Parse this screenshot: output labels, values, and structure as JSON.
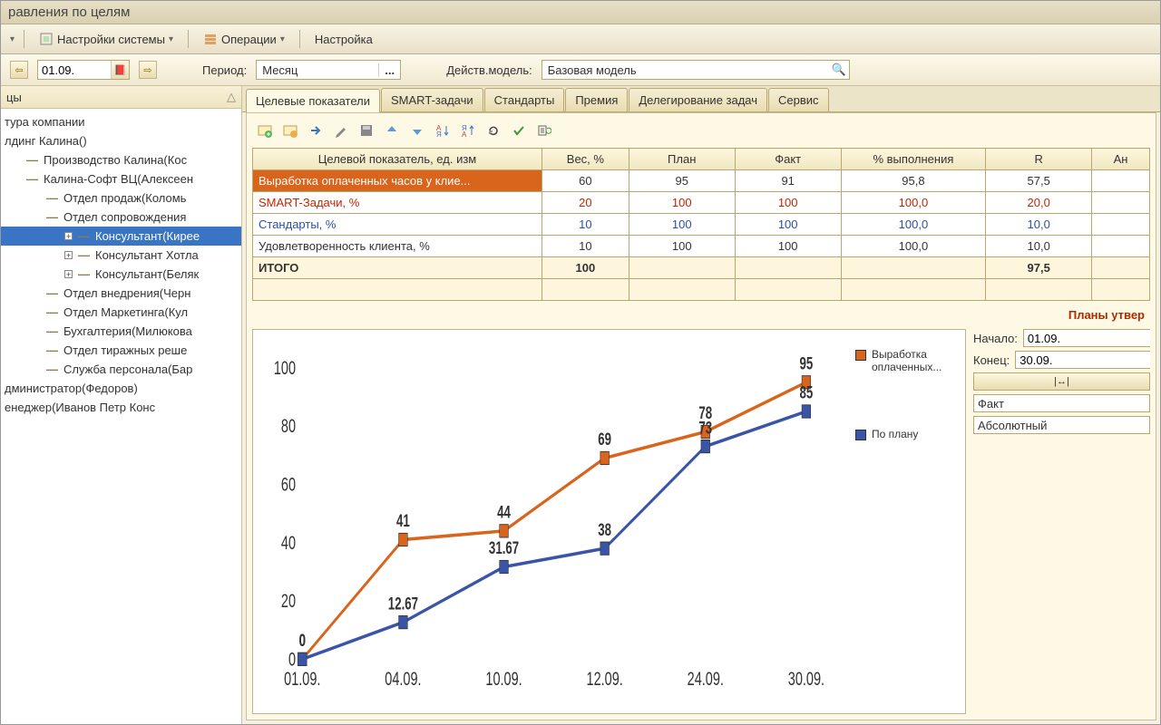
{
  "title": "равления по целям",
  "menu": {
    "settings": "Настройки системы",
    "ops": "Операции",
    "setup": "Настройка"
  },
  "toolbar": {
    "date": "01.09.",
    "period_label": "Период:",
    "period_value": "Месяц",
    "model_label": "Действ.модель:",
    "model_value": "Базовая модель"
  },
  "side_title": "цы",
  "tree": [
    {
      "text": "тура компании",
      "ind": 0
    },
    {
      "text": "лдинг Калина()",
      "ind": 0
    },
    {
      "text": "Производство Калина(Кос",
      "ind": 1,
      "dash": true
    },
    {
      "text": "Калина-Софт ВЦ(Алексеен",
      "ind": 1,
      "dash": true
    },
    {
      "text": "Отдел продаж(Коломь",
      "ind": 2,
      "dash": true
    },
    {
      "text": "Отдел сопровождения",
      "ind": 2,
      "dash": true
    },
    {
      "text": "Консультант(Кирее",
      "ind": 3,
      "plus": true,
      "dash": true,
      "sel": true
    },
    {
      "text": "Консультант Хотла",
      "ind": 3,
      "plus": true,
      "dash": true
    },
    {
      "text": "Консультант(Беляк",
      "ind": 3,
      "plus": true,
      "dash": true
    },
    {
      "text": "Отдел внедрения(Черн",
      "ind": 2,
      "dash": true
    },
    {
      "text": "Отдел Маркетинга(Кул",
      "ind": 2,
      "dash": true
    },
    {
      "text": "Бухгалтерия(Милюкова",
      "ind": 2,
      "dash": true
    },
    {
      "text": "Отдел тиражных реше",
      "ind": 2,
      "dash": true
    },
    {
      "text": "Служба персонала(Бар",
      "ind": 2,
      "dash": true
    },
    {
      "text": "дминистратор(Федоров)",
      "ind": 0
    },
    {
      "text": "енеджер(Иванов Петр Конс",
      "ind": 0
    }
  ],
  "tabs": [
    "Целевые показатели",
    "SMART-задачи",
    "Стандарты",
    "Премия",
    "Делегирование задач",
    "Сервис"
  ],
  "grid": {
    "headers": [
      "Целевой показатель, ед. изм",
      "Вес, %",
      "План",
      "Факт",
      "% выполнения",
      "R",
      "Ан"
    ],
    "rows": [
      {
        "cells": [
          "Выработка оплаченных часов у клие...",
          "60",
          "95",
          "91",
          "95,8",
          "57,5",
          ""
        ],
        "cls": "hl"
      },
      {
        "cells": [
          "SMART-Задачи, %",
          "20",
          "100",
          "100",
          "100,0",
          "20,0",
          ""
        ],
        "cls": "red"
      },
      {
        "cells": [
          "Стандарты, %",
          "10",
          "100",
          "100",
          "100,0",
          "10,0",
          ""
        ],
        "cls": "blue"
      },
      {
        "cells": [
          "Удовлетворенность клиента, %",
          "10",
          "100",
          "100",
          "100,0",
          "10,0",
          ""
        ],
        "cls": ""
      },
      {
        "cells": [
          "ИТОГО",
          "100",
          "",
          "",
          "",
          "97,5",
          ""
        ],
        "cls": "total"
      }
    ]
  },
  "status": "Планы утвер",
  "chart_side": {
    "start_label": "Начало:",
    "start": "01.09.",
    "end_label": "Конец:",
    "end": "30.09.",
    "fact": "Факт",
    "abs": "Абсолютный"
  },
  "legend": {
    "a": "Выработка оплаченных...",
    "b": "По плану"
  },
  "chart_data": {
    "type": "line",
    "categories": [
      "01.09.",
      "04.09.",
      "10.09.",
      "12.09.",
      "24.09.",
      "30.09."
    ],
    "series": [
      {
        "name": "Выработка оплаченных",
        "color": "#d9641c",
        "values": [
          0,
          41,
          44,
          69,
          78,
          95
        ]
      },
      {
        "name": "По плану",
        "color": "#3a54a8",
        "values": [
          0,
          12.67,
          31.67,
          38,
          73,
          85
        ]
      }
    ],
    "ylabel": "",
    "xlabel": "",
    "ylim": [
      0,
      100
    ],
    "yticks": [
      0,
      20,
      40,
      60,
      80,
      100
    ]
  }
}
